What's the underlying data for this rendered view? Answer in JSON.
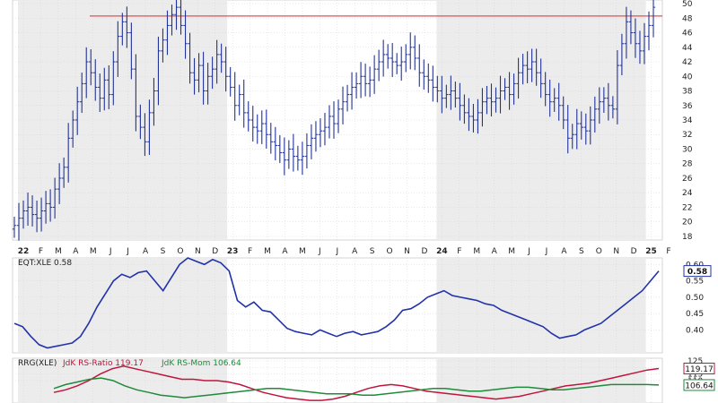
{
  "colors": {
    "price_bars": "#223399",
    "resistance": "#e05050",
    "rs_line": "#2233aa",
    "rs_ratio": "#c0143c",
    "rs_mom": "#1f8a3a",
    "shade": "#ececec",
    "grid": "#d4d4d4"
  },
  "chart_data": [
    {
      "type": "ohlc",
      "panel": "price",
      "x_ticks": [
        "22",
        "F",
        "M",
        "A",
        "M",
        "J",
        "J",
        "A",
        "S",
        "O",
        "N",
        "D",
        "23",
        "F",
        "M",
        "A",
        "M",
        "J",
        "J",
        "A",
        "S",
        "O",
        "N",
        "D",
        "24",
        "F",
        "M",
        "A",
        "M",
        "J",
        "J",
        "A",
        "S",
        "O",
        "N",
        "D",
        "25",
        "F"
      ],
      "y_ticks": [
        "18",
        "20",
        "22",
        "24",
        "26",
        "28",
        "30",
        "32",
        "34",
        "36",
        "38",
        "40",
        "42",
        "44",
        "46",
        "48",
        "50"
      ],
      "ylim": [
        17.5,
        50.5
      ],
      "resistance_level": 48.3,
      "weekly_close": [
        19.5,
        20.5,
        21.5,
        22.0,
        21.0,
        20.5,
        21.5,
        22.5,
        22.0,
        24.5,
        26.0,
        27.5,
        31.5,
        34.0,
        36.5,
        39.0,
        42.0,
        40.5,
        38.5,
        37.0,
        39.5,
        37.5,
        42.0,
        45.5,
        47.5,
        46.0,
        41.0,
        34.5,
        33.0,
        31.0,
        35.0,
        38.0,
        43.5,
        45.0,
        47.0,
        48.5,
        49.5,
        47.0,
        44.5,
        40.5,
        39.5,
        41.5,
        38.0,
        40.0,
        41.0,
        43.0,
        42.0,
        40.0,
        38.5,
        36.0,
        37.5,
        35.0,
        34.0,
        33.0,
        32.5,
        33.5,
        32.0,
        31.0,
        30.5,
        29.5,
        28.5,
        30.0,
        29.0,
        28.5,
        29.0,
        30.5,
        31.5,
        32.0,
        32.5,
        33.0,
        34.5,
        33.5,
        35.5,
        36.5,
        37.5,
        38.5,
        39.0,
        40.0,
        39.0,
        39.5,
        41.0,
        42.0,
        43.0,
        42.5,
        42.0,
        41.5,
        42.0,
        43.0,
        44.0,
        42.5,
        40.5,
        40.0,
        39.5,
        38.5,
        38.0,
        37.0,
        37.5,
        38.0,
        37.0,
        36.0,
        35.0,
        34.5,
        34.0,
        35.0,
        36.5,
        37.0,
        36.5,
        37.0,
        38.0,
        38.5,
        37.5,
        39.0,
        40.5,
        41.5,
        41.0,
        42.0,
        40.5,
        39.0,
        37.5,
        36.5,
        37.0,
        36.0,
        34.0,
        31.5,
        32.0,
        33.5,
        33.0,
        32.5,
        34.0,
        35.5,
        36.5,
        37.0,
        36.0,
        35.5,
        41.5,
        44.5,
        47.5,
        46.0,
        44.5,
        43.5,
        45.5,
        47.0,
        49.5
      ],
      "rows": 1
    },
    {
      "type": "line",
      "panel": "relative-strength",
      "title": "EQT:XLE 0.58",
      "series": [
        {
          "name": "EQT:XLE",
          "values": [
            0.42,
            0.41,
            0.38,
            0.355,
            0.345,
            0.35,
            0.355,
            0.36,
            0.38,
            0.42,
            0.47,
            0.51,
            0.55,
            0.57,
            0.56,
            0.575,
            0.58,
            0.55,
            0.52,
            0.56,
            0.6,
            0.62,
            0.61,
            0.6,
            0.615,
            0.605,
            0.58,
            0.49,
            0.47,
            0.485,
            0.46,
            0.455,
            0.43,
            0.405,
            0.395,
            0.39,
            0.385,
            0.4,
            0.39,
            0.38,
            0.39,
            0.395,
            0.385,
            0.39,
            0.395,
            0.41,
            0.43,
            0.46,
            0.465,
            0.48,
            0.5,
            0.51,
            0.52,
            0.505,
            0.5,
            0.495,
            0.49,
            0.48,
            0.475,
            0.46,
            0.45,
            0.44,
            0.43,
            0.42,
            0.41,
            0.39,
            0.375,
            0.38,
            0.385,
            0.4,
            0.41,
            0.42,
            0.44,
            0.46,
            0.48,
            0.5,
            0.52,
            0.55,
            0.58
          ]
        }
      ],
      "y_ticks": [
        "0.40",
        "0.45",
        "0.50",
        "0.55",
        "0.60"
      ],
      "last_label": "0.58",
      "ylim": [
        0.33,
        0.62
      ]
    },
    {
      "type": "line",
      "panel": "rrg",
      "title_parts": [
        "RRG(XLE)",
        "JdK RS-Ratio 119.17",
        "JdK RS-Mom 106.64"
      ],
      "series": [
        {
          "name": "JdK RS-Ratio",
          "values": [
            101,
            103,
            106,
            110,
            115,
            119,
            121,
            119,
            117,
            115,
            113,
            111,
            111,
            110,
            110,
            109,
            107,
            104,
            101,
            99,
            97,
            96,
            95,
            95,
            96,
            98,
            101,
            104,
            106,
            107,
            106,
            104,
            102,
            101,
            100,
            99,
            98,
            97,
            96,
            97,
            98,
            100,
            102,
            104,
            106,
            107,
            108,
            110,
            112,
            114,
            116,
            118,
            119.17
          ]
        },
        {
          "name": "JdK RS-Mom",
          "values": [
            104,
            107,
            109,
            111,
            112,
            110,
            106,
            103,
            101,
            99,
            98,
            97,
            98,
            99,
            100,
            101,
            102,
            103,
            104,
            104,
            103,
            102,
            101,
            100,
            100,
            100,
            99,
            99,
            100,
            101,
            102,
            103,
            104,
            104,
            103,
            102,
            102,
            103,
            104,
            105,
            105,
            104,
            103,
            103,
            104,
            105,
            106,
            107,
            107,
            107,
            107,
            106.64
          ]
        }
      ],
      "y_ticks": [
        "110",
        "115",
        "120",
        "125"
      ],
      "last_labels": [
        "119.17",
        "106.64"
      ],
      "ylim": [
        93,
        127
      ]
    }
  ]
}
